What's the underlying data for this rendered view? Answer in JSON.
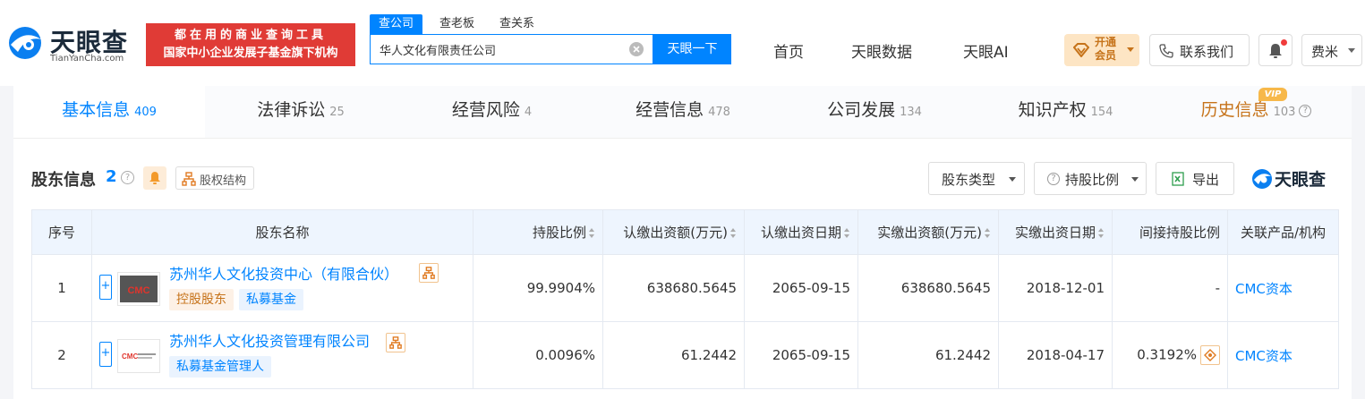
{
  "header": {
    "logo_text": "天眼查",
    "logo_sub": "TianYanCha.com",
    "slogan_line1": "都在用的商业查询工具",
    "slogan_line2": "国家中小企业发展子基金旗下机构",
    "search_tabs": [
      "查公司",
      "查老板",
      "查关系"
    ],
    "search_value": "华人文化有限责任公司",
    "search_button": "天眼一下",
    "nav": [
      "首页",
      "天眼数据",
      "天眼AI"
    ],
    "vip_line1": "开通",
    "vip_line2": "会员",
    "contact": "联系我们",
    "user": "费米"
  },
  "tabs": [
    {
      "label": "基本信息",
      "count": "409"
    },
    {
      "label": "法律诉讼",
      "count": "25"
    },
    {
      "label": "经营风险",
      "count": "4"
    },
    {
      "label": "经营信息",
      "count": "478"
    },
    {
      "label": "公司发展",
      "count": "134"
    },
    {
      "label": "知识产权",
      "count": "154"
    },
    {
      "label": "历史信息",
      "count": "103"
    }
  ],
  "vip_badge": "VIP",
  "section": {
    "title": "股东信息",
    "count": "2",
    "equity_button": "股权结构",
    "type_button": "股东类型",
    "ratio_button": "持股比例",
    "export_button": "导出",
    "brand": "天眼查"
  },
  "table": {
    "headers": [
      "序号",
      "股东名称",
      "持股比例",
      "认缴出资额(万元)",
      "认缴出资日期",
      "实缴出资额(万元)",
      "实缴出资日期",
      "间接持股比例",
      "关联产品/机构"
    ],
    "rows": [
      {
        "index": "1",
        "name": "苏州华人文化投资中心（有限合伙）",
        "tags": [
          "控股股东",
          "私募基金"
        ],
        "ratio": "99.9904%",
        "subscribed_amount": "638680.5645",
        "subscribed_date": "2065-09-15",
        "paid_amount": "638680.5645",
        "paid_date": "2018-12-01",
        "indirect_ratio": "-",
        "related": "CMC资本"
      },
      {
        "index": "2",
        "name": "苏州华人文化投资管理有限公司",
        "tags": [
          "私募基金管理人"
        ],
        "ratio": "0.0096%",
        "subscribed_amount": "61.2442",
        "subscribed_date": "2065-09-15",
        "paid_amount": "61.2442",
        "paid_date": "2018-04-17",
        "indirect_ratio": "0.3192%",
        "related": "CMC资本"
      }
    ]
  },
  "colors": {
    "accent": "#0084ff",
    "slogan_bg": "#e03b36",
    "vip": "#c6731a",
    "header_bg_table": "#eef5fe"
  }
}
